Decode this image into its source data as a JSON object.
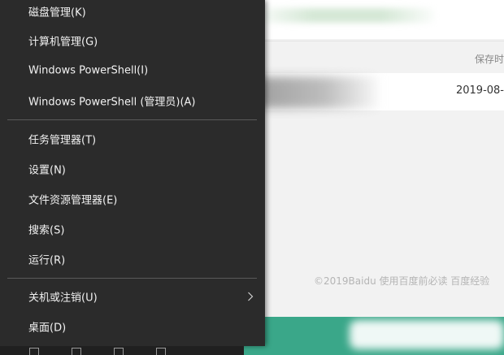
{
  "menu": {
    "items": [
      {
        "label": "磁盘管理(K)"
      },
      {
        "label": "计算机管理(G)"
      },
      {
        "label": "Windows PowerShell(I)"
      },
      {
        "label": "Windows PowerShell (管理员)(A)"
      },
      {
        "label": "任务管理器(T)"
      },
      {
        "label": "设置(N)"
      },
      {
        "label": "文件资源管理器(E)"
      },
      {
        "label": "搜索(S)"
      },
      {
        "label": "运行(R)"
      },
      {
        "label": "关机或注销(U)",
        "has_submenu": true
      },
      {
        "label": "桌面(D)"
      }
    ]
  },
  "background_page": {
    "save_label": "保存时",
    "date": "2019-08-",
    "footer": "©2019Baidu  使用百度前必读  百度经验"
  },
  "colors": {
    "menu_bg": "#2b2b2b",
    "menu_text": "#f2f2f2",
    "separator": "#5a5a5a",
    "page_bg": "#f2f2f2",
    "accent_green": "#3aa789"
  }
}
